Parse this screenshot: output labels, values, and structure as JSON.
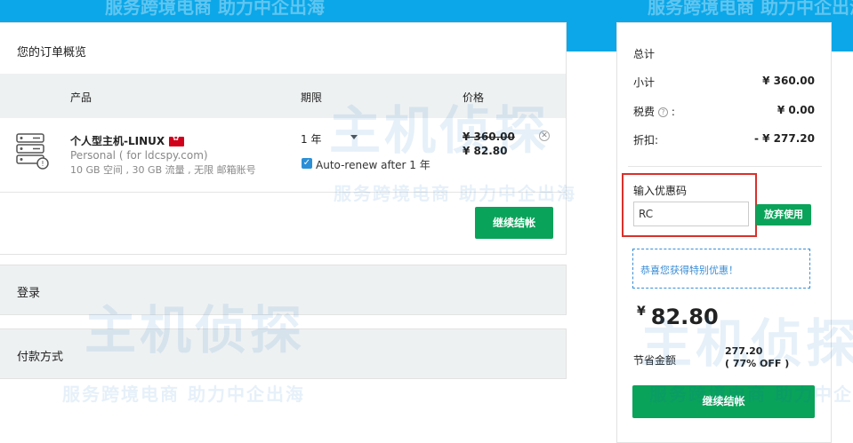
{
  "watermark": {
    "brand": "主机侦探",
    "slogan": "服务跨境电商 助力中企出海"
  },
  "order": {
    "title": "您的订单概览",
    "headers": {
      "product": "产品",
      "period": "期限",
      "price": "价格"
    },
    "item": {
      "name": "个人型主机-LINUX",
      "desc1": "Personal ( for ldcspy.com)",
      "desc2": "10 GB 空间 , 30 GB 流量 , 无限 邮箱账号",
      "period": "1 年",
      "auto_renew_label": "Auto-renew after 1 年",
      "auto_renew_checked": true,
      "old_price": "¥ 360.00",
      "new_price": "¥ 82.80"
    },
    "continue_label": "继续结帐"
  },
  "panels": {
    "login": "登录",
    "payment": "付款方式"
  },
  "summary": {
    "title": "总计",
    "subtotal_label": "小计",
    "subtotal_value": "¥ 360.00",
    "tax_label": "税费",
    "tax_colon": ":",
    "tax_value": "¥ 0.00",
    "discount_label": "折扣:",
    "discount_value": "- ¥ 277.20",
    "promo_label": "输入优惠码",
    "promo_value": "RC",
    "apply_label": "放弃使用",
    "notice": "恭喜您获得特别优惠！",
    "total_currency": "¥",
    "total_amount": "82.80",
    "savings_label": "节省金额",
    "savings_amount": "277.20",
    "savings_percent": "( 77% OFF )",
    "continue_label": "继续结帐"
  },
  "colors": {
    "accent_green": "#0aa35a",
    "header_blue": "#0ba7e8",
    "highlight_red": "#d9312b",
    "link_blue": "#3a8ed6"
  }
}
